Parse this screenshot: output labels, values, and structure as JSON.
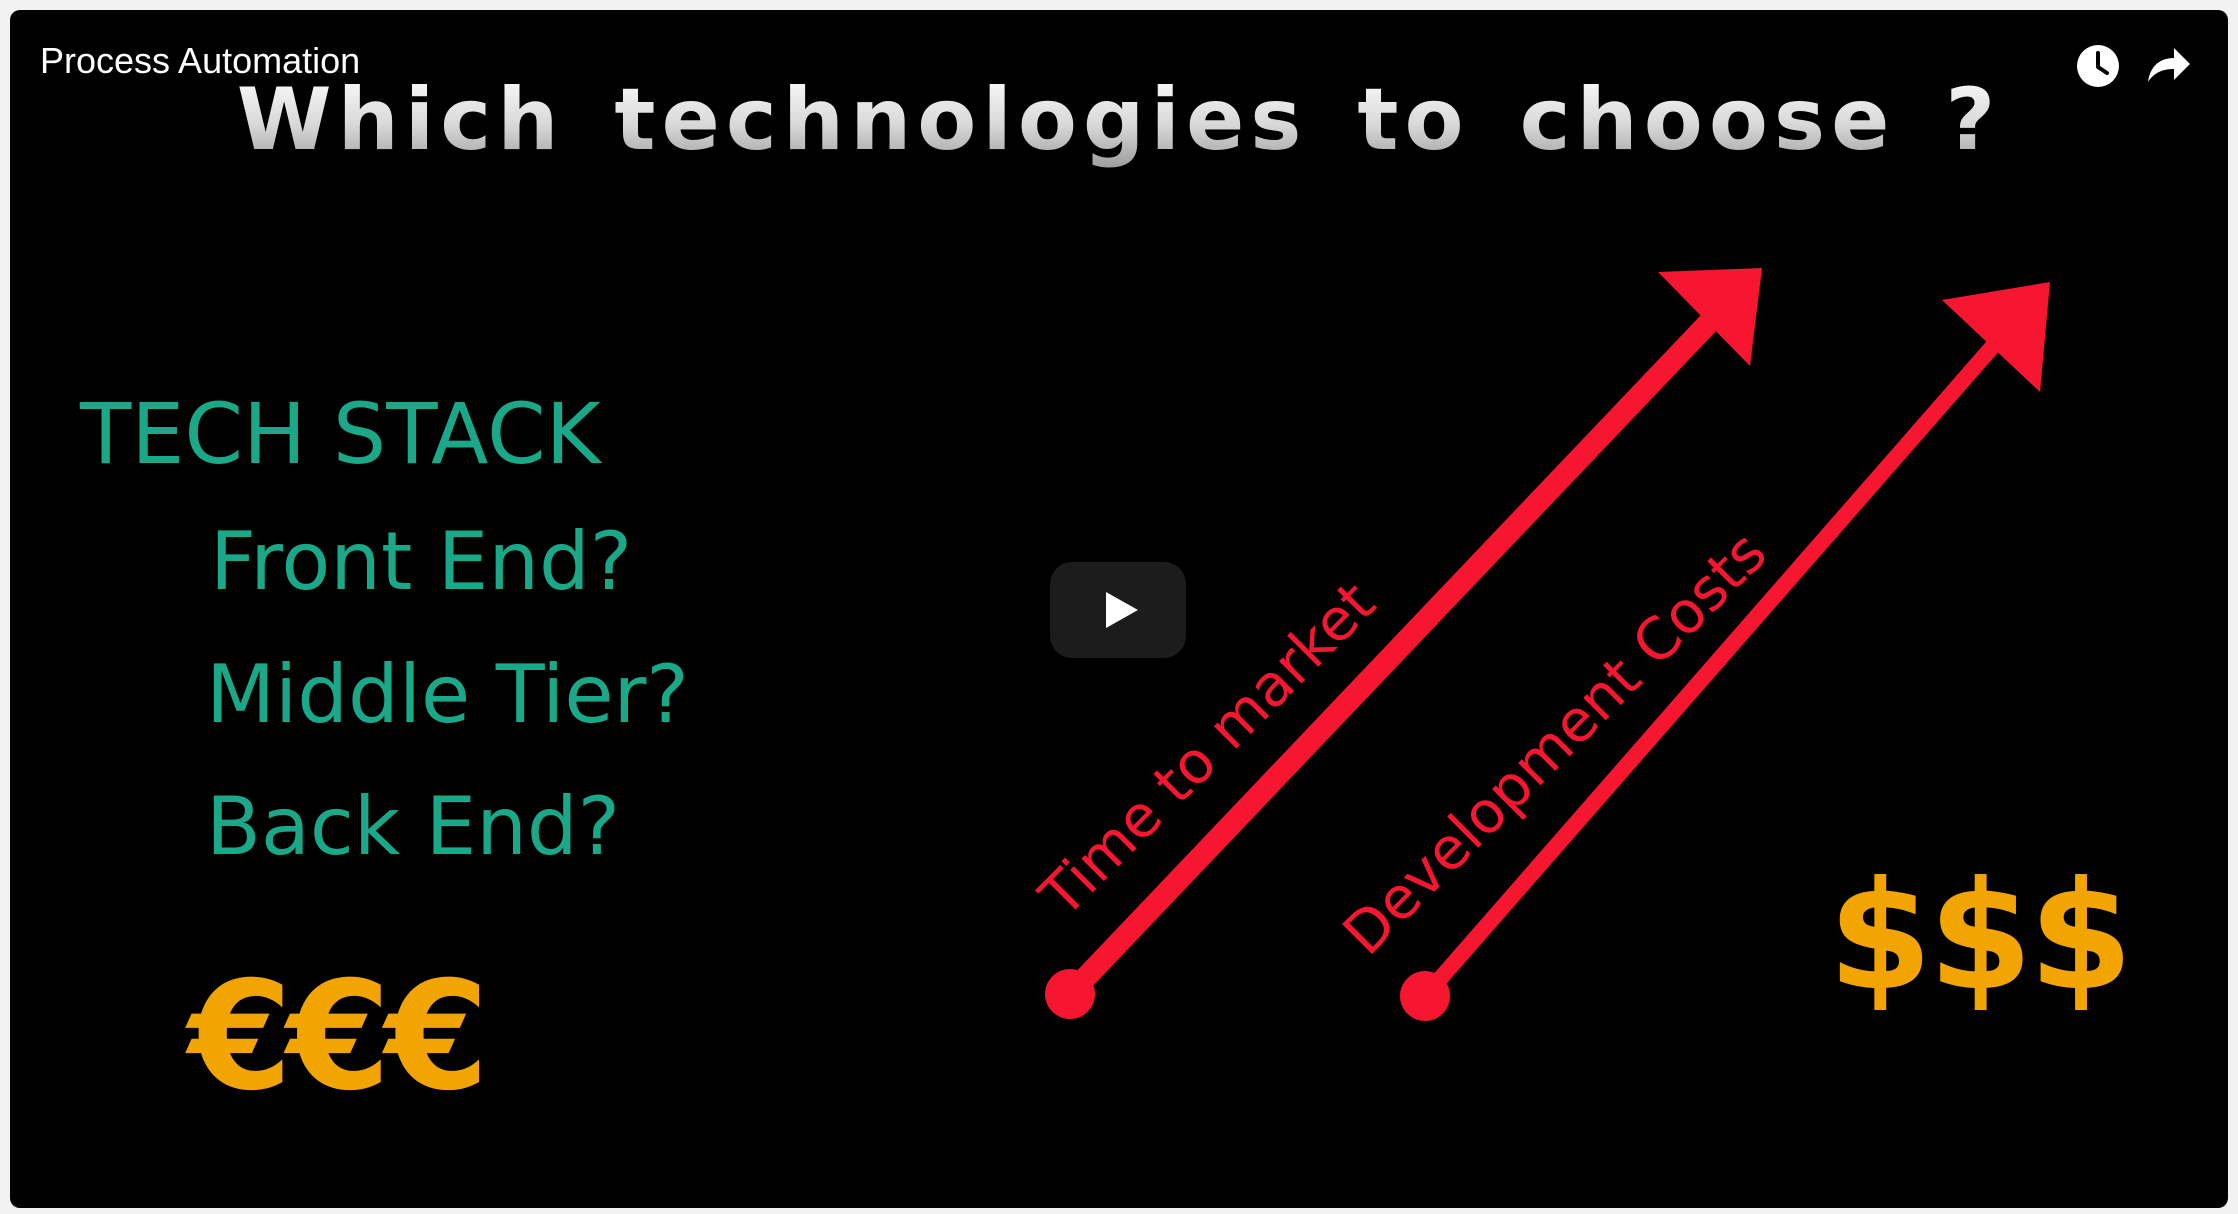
{
  "player": {
    "title": "Process Automation",
    "icons": {
      "watch_later": "clock-icon",
      "share": "share-icon",
      "play": "play-icon"
    }
  },
  "slide": {
    "heading": "Which technologies to choose ?",
    "tech_stack": {
      "title": "TECH STACK",
      "items": [
        "Front End?",
        "Middle Tier?",
        "Back End?"
      ]
    },
    "arrows": [
      {
        "label": "Time to market",
        "color": "#f6162f"
      },
      {
        "label": "Development Costs",
        "color": "#f6162f"
      }
    ],
    "euro_symbols": "€€€",
    "dollar_symbols": "$$$",
    "colors": {
      "background": "#000000",
      "teal_text": "#1aa889",
      "currency": "#f2a400",
      "arrow": "#f6162f"
    }
  }
}
